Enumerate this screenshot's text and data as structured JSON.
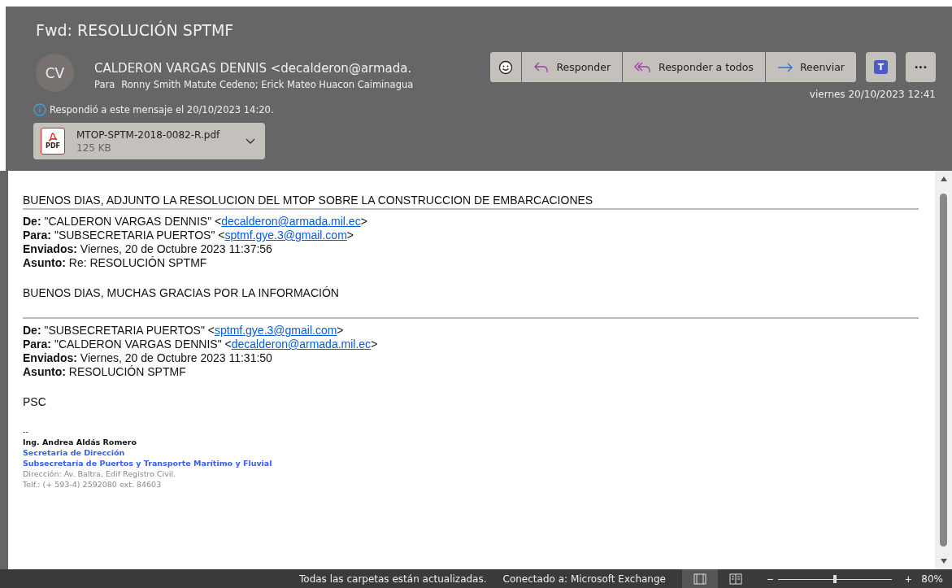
{
  "message": {
    "subject": "Fwd: RESOLUCIÓN SPTMF",
    "avatar": "CV",
    "sender": "CALDERON VARGAS DENNIS <decalderon@armada.",
    "to_label": "Para",
    "to": "Ronny Smith Matute Cedeno; Erick Mateo Huacon Caiminagua",
    "info": "Respondió a este mensaje el 20/10/2023 14:20.",
    "date": "viernes 20/10/2023 12:41",
    "attachment": {
      "name": "MTOP-SPTM-2018-0082-R.pdf",
      "size": "125 KB",
      "badge": "PDF"
    }
  },
  "actions": [
    {
      "kind": "emoji"
    },
    {
      "kind": "reply",
      "label": "Responder"
    },
    {
      "kind": "reply_all",
      "label": "Responder a todos"
    },
    {
      "kind": "forward",
      "label": "Reenviar"
    }
  ],
  "extra_buttons": [
    {
      "kind": "teams",
      "label": "T"
    },
    {
      "kind": "more",
      "label": "···"
    }
  ],
  "body": [
    {
      "kind": "text",
      "text": "BUENOS DIAS, ADJUNTO LA RESOLUCION DEL MTOP SOBRE LA CONSTRUCCION DE EMBARCACIONES"
    },
    {
      "kind": "rule"
    },
    {
      "kind": "header",
      "fields": [
        {
          "label": "De:",
          "value": " \"CALDERON VARGAS DENNIS\" <",
          "link": "decalderon@armada.mil.ec",
          "after": ">"
        },
        {
          "label": "Para:",
          "value": " \"SUBSECRETARIA PUERTOS\" <",
          "link": "sptmf.gye.3@gmail.com",
          "after": ">"
        },
        {
          "label": "Enviados:",
          "value": " Viernes, 20 de Octubre 2023 11:37:56"
        },
        {
          "label": "Asunto:",
          "value": " Re: RESOLUCIÓN SPTMF"
        }
      ]
    },
    {
      "kind": "text",
      "text": "BUENOS DIAS, MUCHAS GRACIAS POR LA INFORMACIÓN"
    },
    {
      "kind": "rule"
    },
    {
      "kind": "header",
      "fields": [
        {
          "label": "De:",
          "value": " \"SUBSECRETARIA PUERTOS\" <",
          "link": "sptmf.gye.3@gmail.com",
          "after": ">"
        },
        {
          "label": "Para:",
          "value": " \"CALDERON VARGAS DENNIS\" <",
          "link": "decalderon@armada.mil.ec",
          "after": ">"
        },
        {
          "label": "Enviados:",
          "value": " Viernes, 20 de Octubre 2023 11:31:50"
        },
        {
          "label": "Asunto:",
          "value": " RESOLUCIÓN SPTMF"
        }
      ]
    },
    {
      "kind": "text",
      "text": "PSC"
    },
    {
      "kind": "signature",
      "lines": [
        {
          "kind": "plain",
          "text": "--"
        },
        {
          "kind": "name",
          "text": "Ing. Andrea Aldás Romero"
        },
        {
          "kind": "blue",
          "text": "Secretaria de Dirección"
        },
        {
          "kind": "blue",
          "text": "Subsecretaría de Puertos y Transporte Marítimo y Fluvial"
        },
        {
          "kind": "grey",
          "text": "Dirección: Av. Baltra, Edif Registro Civil."
        },
        {
          "kind": "grey",
          "text": "Telf.: (+ 593-4) 2592080  ext. 84603"
        }
      ]
    }
  ],
  "status_bar": {
    "texts": [
      "Todas las carpetas están actualizadas.",
      "Conectado a: Microsoft Exchange"
    ],
    "views": [
      {
        "kind": "normal",
        "selected": true
      },
      {
        "kind": "reading",
        "selected": false
      }
    ],
    "zoom": {
      "minus": "−",
      "plus": "+",
      "level": 0.5,
      "reading": "80%"
    }
  }
}
